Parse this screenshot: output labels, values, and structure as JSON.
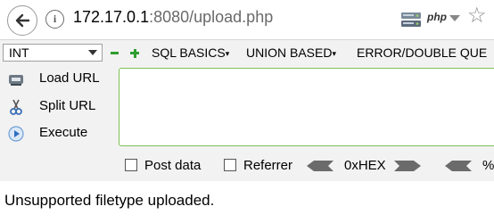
{
  "browser": {
    "url_host": "172.17.0.1",
    "url_rest": ":8080/upload.php",
    "php_badge": "php"
  },
  "hackbar": {
    "select_value": "INT",
    "menus": [
      "SQL BASICS",
      "UNION BASED",
      "ERROR/DOUBLE QUE"
    ],
    "commands": [
      "Load URL",
      "Split URL",
      "Execute"
    ],
    "options": [
      "Post data",
      "Referrer"
    ],
    "encoder": "0xHEX",
    "encoder2": "%",
    "accent_color": "#2e9d2e"
  },
  "page": {
    "message": "Unsupported filetype uploaded."
  }
}
